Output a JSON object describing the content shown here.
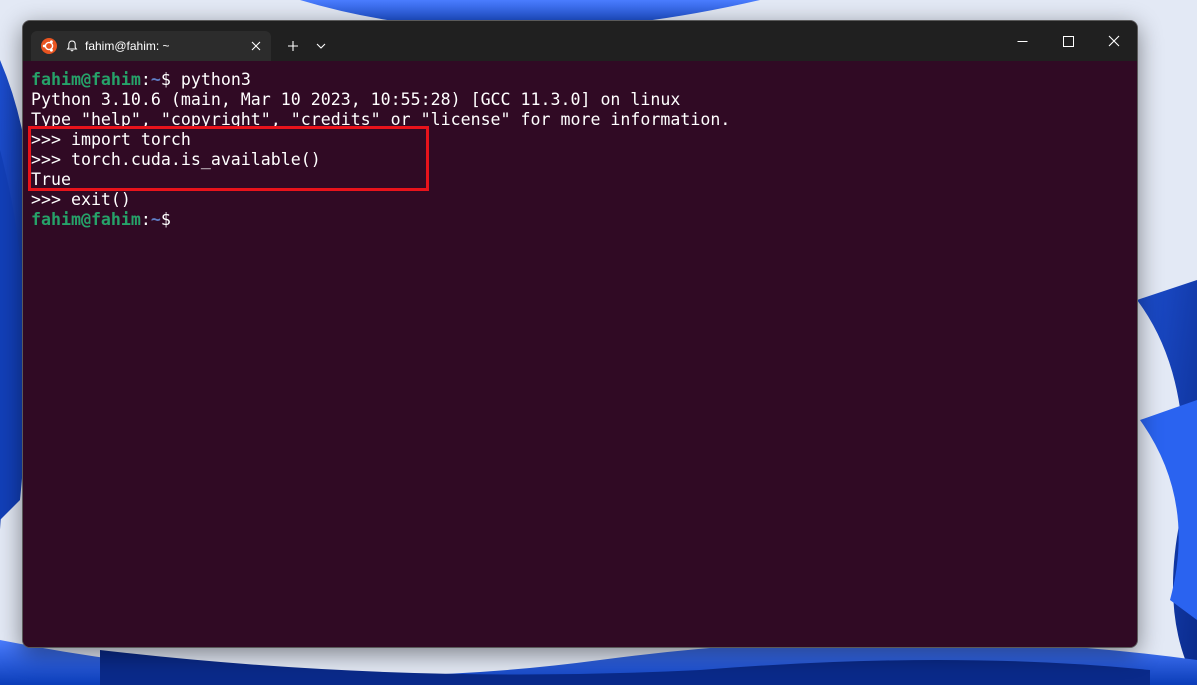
{
  "colors": {
    "terminal_bg": "#300a24",
    "prompt_user": "#26a269",
    "prompt_path": "#5e7cc4",
    "highlight": "#e8131b",
    "titlebar": "#202020"
  },
  "tab": {
    "title": "fahim@fahim: ~",
    "icon": "ubuntu-icon",
    "bell_icon": "bell-icon",
    "close_icon": "close-icon"
  },
  "titlebar": {
    "new_tab_icon": "plus-icon",
    "dropdown_icon": "chevron-down-icon",
    "minimize_icon": "minimize-icon",
    "maximize_icon": "maximize-icon",
    "close_icon": "close-icon"
  },
  "terminal": {
    "lines": [
      {
        "user": "fahim@fahim",
        "sep": ":",
        "path": "~",
        "sym": "$ ",
        "text": "python3"
      },
      {
        "text": "Python 3.10.6 (main, Mar 10 2023, 10:55:28) [GCC 11.3.0] on linux"
      },
      {
        "text": "Type \"help\", \"copyright\", \"credits\" or \"license\" for more information."
      },
      {
        "text": ">>> import torch"
      },
      {
        "text": ">>> torch.cuda.is_available()"
      },
      {
        "text": "True"
      },
      {
        "text": ">>> exit()"
      },
      {
        "user": "fahim@fahim",
        "sep": ":",
        "path": "~",
        "sym": "$",
        "text": ""
      }
    ]
  }
}
